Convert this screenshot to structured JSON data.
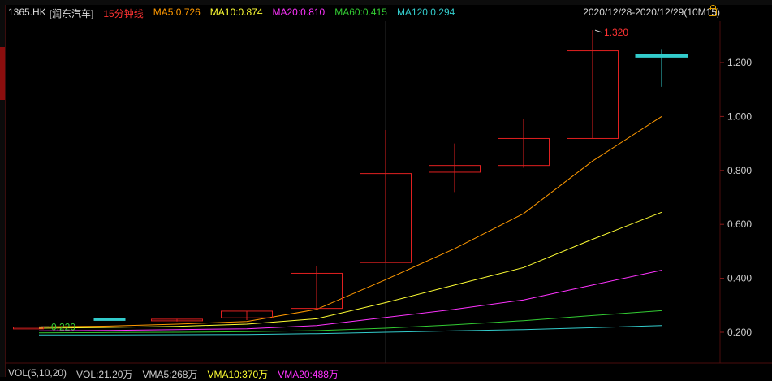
{
  "title": {
    "symbol": "1365.HK",
    "name": "[润东汽车]",
    "period": "15分钟线"
  },
  "ma_legend": [
    {
      "label": "MA5:0.726",
      "color": "#ff9900"
    },
    {
      "label": "MA10:0.874",
      "color": "#ffff33"
    },
    {
      "label": "MA20:0.810",
      "color": "#ff33ff"
    },
    {
      "label": "MA60:0.415",
      "color": "#33cc33"
    },
    {
      "label": "MA120:0.294",
      "color": "#33cccc"
    }
  ],
  "date_range": "2020/12/28-2020/12/29(10M15)",
  "vol_legend": [
    {
      "label": "VOL(5,10,20)",
      "color": "#cccccc"
    },
    {
      "label": "VOL:21.20万",
      "color": "#cccccc"
    },
    {
      "label": "VMA5:268万",
      "color": "#cccccc"
    },
    {
      "label": "VMA10:370万",
      "color": "#ffff33"
    },
    {
      "label": "VMA20:488万",
      "color": "#ff33ff"
    }
  ],
  "annotations": {
    "high_label": "1.320",
    "low_label": "0.220"
  },
  "chart_data": {
    "type": "candlestick",
    "y_ticks": [
      "1.200",
      "1.000",
      "0.800",
      "0.600",
      "0.400",
      "0.200"
    ],
    "y_tick_values": [
      1.2,
      1.0,
      0.8,
      0.6,
      0.4,
      0.2
    ],
    "ylim": [
      0.14,
      1.36
    ],
    "candles": [
      {
        "open": 0.22,
        "close": 0.22,
        "high": 0.22,
        "low": 0.22,
        "color": "red"
      },
      {
        "open": 0.25,
        "close": 0.25,
        "high": 0.25,
        "low": 0.25,
        "color": "cyan"
      },
      {
        "open": 0.25,
        "close": 0.245,
        "high": 0.25,
        "low": 0.24,
        "color": "red"
      },
      {
        "open": 0.255,
        "close": 0.28,
        "high": 0.28,
        "low": 0.245,
        "color": "red"
      },
      {
        "open": 0.29,
        "close": 0.42,
        "high": 0.445,
        "low": 0.285,
        "color": "red"
      },
      {
        "open": 0.46,
        "close": 0.79,
        "high": 0.95,
        "low": 0.46,
        "color": "red"
      },
      {
        "open": 0.795,
        "close": 0.82,
        "high": 0.9,
        "low": 0.72,
        "color": "red"
      },
      {
        "open": 0.82,
        "close": 0.92,
        "high": 0.99,
        "low": 0.81,
        "color": "red"
      },
      {
        "open": 0.92,
        "close": 1.245,
        "high": 1.32,
        "low": 0.92,
        "color": "red"
      },
      {
        "open": 1.23,
        "close": 1.22,
        "high": 1.25,
        "low": 1.11,
        "color": "cyan"
      }
    ],
    "ma_lines": [
      {
        "name": "MA5",
        "color": "#ff9900",
        "values": [
          0.22,
          0.223,
          0.23,
          0.24,
          0.285,
          0.395,
          0.51,
          0.64,
          0.835,
          1.0
        ]
      },
      {
        "name": "MA10",
        "color": "#ffff33",
        "values": [
          0.215,
          0.218,
          0.222,
          0.23,
          0.25,
          0.31,
          0.375,
          0.44,
          0.545,
          0.645
        ]
      },
      {
        "name": "MA20",
        "color": "#ff33ff",
        "values": [
          0.205,
          0.207,
          0.21,
          0.213,
          0.225,
          0.255,
          0.285,
          0.32,
          0.375,
          0.43
        ]
      },
      {
        "name": "MA60",
        "color": "#33cc33",
        "values": [
          0.198,
          0.199,
          0.2,
          0.202,
          0.206,
          0.215,
          0.228,
          0.243,
          0.262,
          0.28
        ]
      },
      {
        "name": "MA120",
        "color": "#33cccc",
        "values": [
          0.19,
          0.19,
          0.191,
          0.192,
          0.195,
          0.2,
          0.205,
          0.21,
          0.217,
          0.225
        ]
      }
    ]
  }
}
